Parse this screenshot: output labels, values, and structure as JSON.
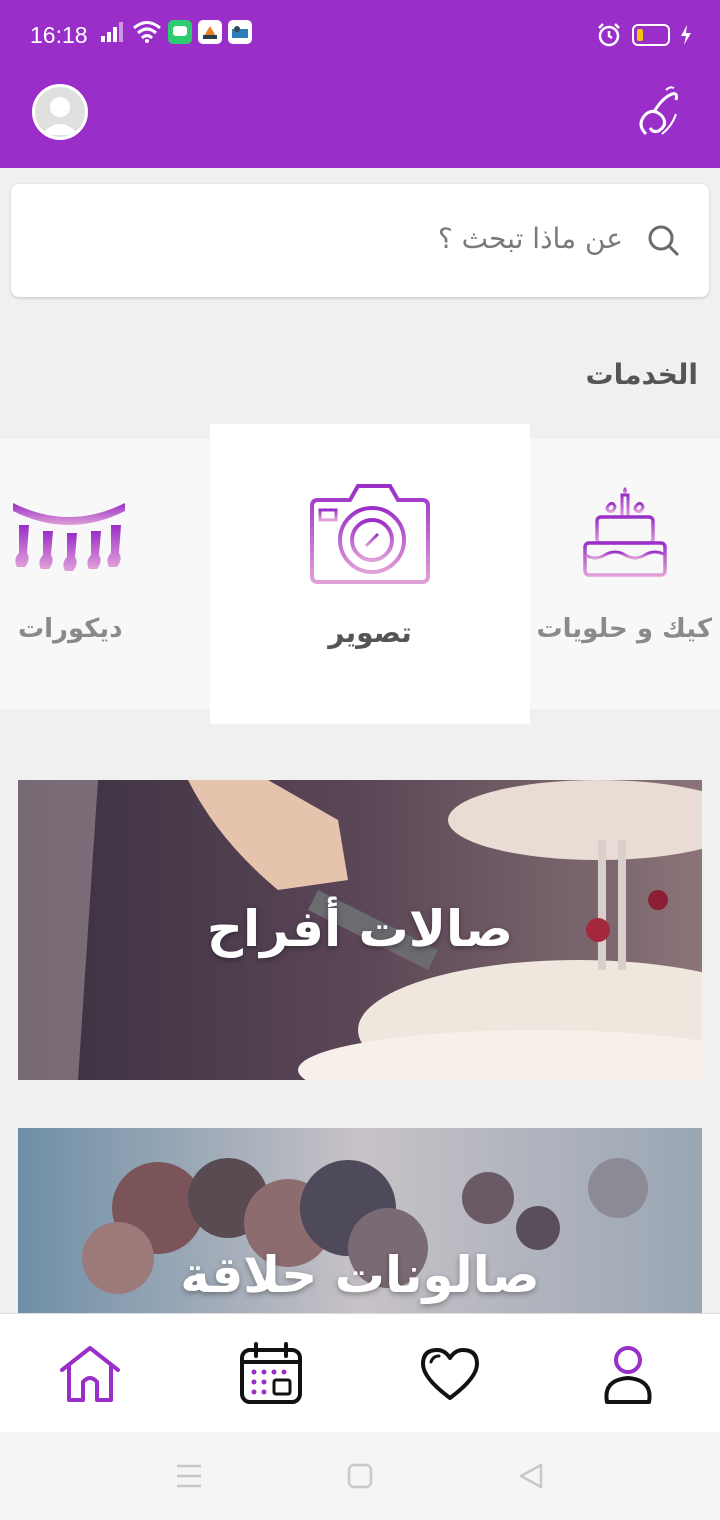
{
  "status_bar": {
    "time": "16:18",
    "signal_icon": "signal-icon",
    "wifi_icon": "wifi-icon",
    "alarm_icon": "alarm-icon",
    "battery_icon": "battery-icon",
    "app_icons": [
      "chat-app-icon",
      "navigation-app-icon",
      "app-icon-1"
    ]
  },
  "app_bar": {
    "avatar_icon": "account-avatar-icon",
    "logo_icon": "calligraphy-logo-icon",
    "accent_color": "#9a2ec8"
  },
  "search": {
    "placeholder": "عن ماذا تبحث ؟",
    "icon": "search-icon"
  },
  "services": {
    "title": "الخدمات",
    "items": [
      {
        "label": "كيك و حلويات",
        "icon": "cake-icon"
      },
      {
        "label": "تصوير",
        "icon": "camera-icon",
        "selected": true
      },
      {
        "label": "ديكورات",
        "icon": "decorations-icon"
      }
    ]
  },
  "banners": [
    {
      "title": "صالات أفراح"
    },
    {
      "title": "صالونات حلاقة"
    }
  ],
  "bottom_nav": {
    "items": [
      {
        "name": "home",
        "icon": "home-icon",
        "active": true
      },
      {
        "name": "calendar",
        "icon": "calendar-icon"
      },
      {
        "name": "favorites",
        "icon": "heart-icon"
      },
      {
        "name": "profile",
        "icon": "user-icon"
      }
    ]
  }
}
